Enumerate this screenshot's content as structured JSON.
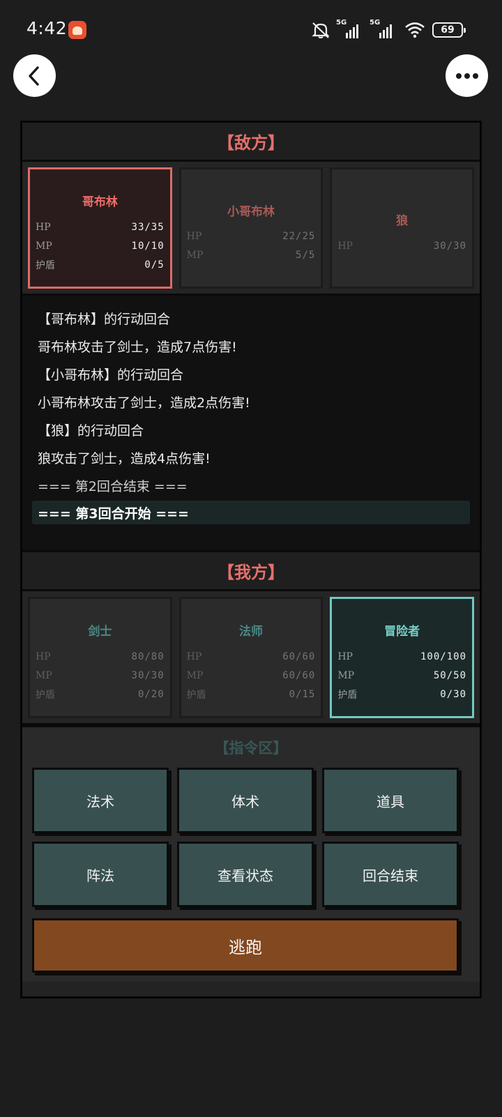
{
  "status_bar": {
    "time": "4:42",
    "signal_labels": [
      "5G",
      "5G"
    ],
    "battery": "69",
    "icons": [
      "app-notification-icon",
      "mute-icon",
      "signal-icon",
      "wifi-icon",
      "battery-icon"
    ]
  },
  "nav": {
    "back_icon": "chevron-left-icon",
    "more_icon": "more-dots-icon"
  },
  "enemy": {
    "header": "【敌方】",
    "units": [
      {
        "name": "哥布林",
        "stats": [
          {
            "label": "HP",
            "value": "33/35"
          },
          {
            "label": "MP",
            "value": "10/10"
          },
          {
            "label": "护盾",
            "value": "0/5"
          }
        ],
        "active": true
      },
      {
        "name": "小哥布林",
        "stats": [
          {
            "label": "HP",
            "value": "22/25"
          },
          {
            "label": "MP",
            "value": "5/5"
          }
        ],
        "active": false
      },
      {
        "name": "狼",
        "stats": [
          {
            "label": "HP",
            "value": "30/30"
          }
        ],
        "active": false
      }
    ]
  },
  "log": [
    "【哥布林】的行动回合",
    "哥布林攻击了剑士，造成7点伤害!",
    "【小哥布林】的行动回合",
    "小哥布林攻击了剑士，造成2点伤害!",
    "【狼】的行动回合",
    "狼攻击了剑士，造成4点伤害!",
    "=== 第2回合结束 ===",
    "=== 第3回合开始 ==="
  ],
  "ally": {
    "header": "【我方】",
    "units": [
      {
        "name": "剑士",
        "stats": [
          {
            "label": "HP",
            "value": "80/80"
          },
          {
            "label": "MP",
            "value": "30/30"
          },
          {
            "label": "护盾",
            "value": "0/20"
          }
        ],
        "active": false
      },
      {
        "name": "法师",
        "stats": [
          {
            "label": "HP",
            "value": "60/60"
          },
          {
            "label": "MP",
            "value": "60/60"
          },
          {
            "label": "护盾",
            "value": "0/15"
          }
        ],
        "active": false
      },
      {
        "name": "冒险者",
        "stats": [
          {
            "label": "HP",
            "value": "100/100"
          },
          {
            "label": "MP",
            "value": "50/50"
          },
          {
            "label": "护盾",
            "value": "0/30"
          }
        ],
        "active": true
      }
    ]
  },
  "commands": {
    "title": "【指令区】",
    "buttons": [
      "法术",
      "体术",
      "道具",
      "阵法",
      "查看状态",
      "回合结束"
    ],
    "flee": "逃跑"
  },
  "colors": {
    "background": "#1d1d1d",
    "enemy_accent": "#e5706c",
    "ally_accent": "#72c9c1",
    "command_button": "#395050",
    "flee_button": "#824820"
  }
}
